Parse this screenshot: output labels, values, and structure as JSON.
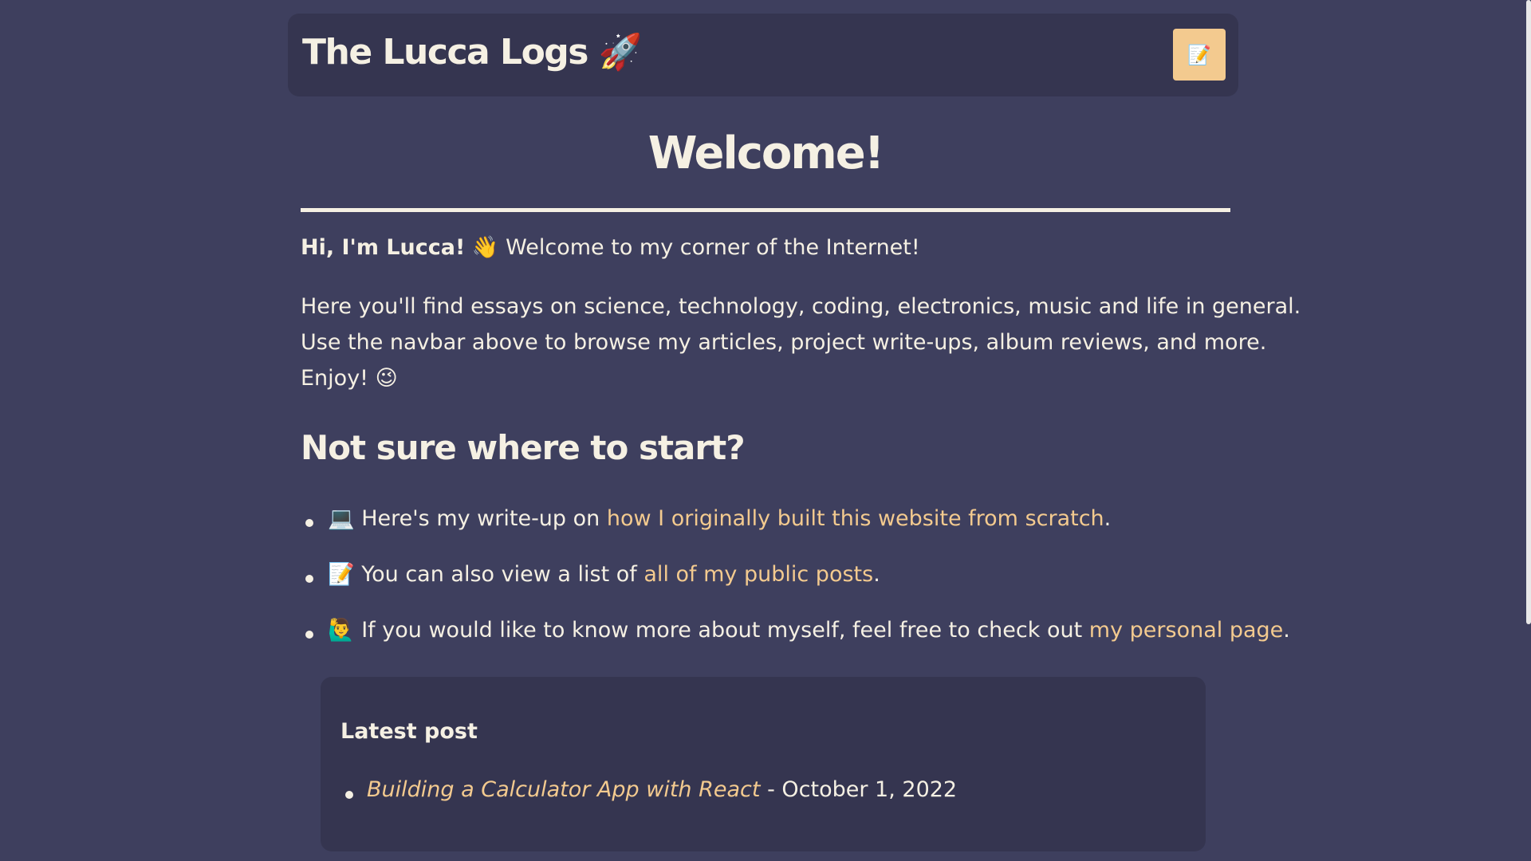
{
  "header": {
    "site_title": "The Lucca Logs 🚀",
    "menu_button_icon": "📝"
  },
  "main": {
    "title": "Welcome!",
    "intro_bold": "Hi, I'm Lucca!",
    "intro_emoji": "👋",
    "intro_rest": "Welcome to my corner of the Internet!",
    "paragraph_lines": [
      "Here you'll find essays on science, technology, coding, electronics, music and life in general.",
      "Use the navbar above to browse my articles, project write-ups, album reviews, and more.",
      "Enjoy! 😉"
    ],
    "section_title": "Not sure where to start?",
    "start_items": [
      {
        "emoji": "💻",
        "prefix": "Here's my write-up on",
        "link": "how I originally built this website from scratch",
        "suffix": "."
      },
      {
        "emoji": "📝",
        "prefix": "You can also view a list of",
        "link": "all of my public posts",
        "suffix": "."
      },
      {
        "emoji": "🙋‍♂️",
        "prefix": "If you would like to know more about myself, feel free to check out",
        "link": "my personal page",
        "suffix": "."
      }
    ]
  },
  "latest": {
    "heading": "Latest post",
    "post_title": "Building a Calculator App with React",
    "separator": "-",
    "post_date": "October 1, 2022"
  },
  "colors": {
    "background": "#3e3f5e",
    "panel": "#353550",
    "text": "#f5f0e3",
    "accent": "#f3ca8f"
  }
}
